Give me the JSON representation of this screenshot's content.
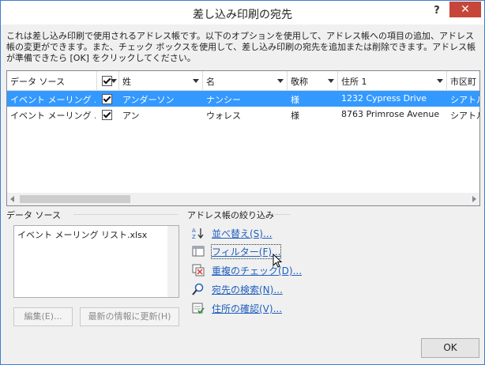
{
  "window": {
    "title": "差し込み印刷の宛先",
    "help": "?",
    "close": "✕"
  },
  "description": "これは差し込み印刷で使用されるアドレス帳です。以下のオプションを使用して、アドレス帳への項目の追加、アドレス帳の変更ができます。また、チェック ボックスを使用して、差し込み印刷の宛先を追加または削除できます。アドレス帳が準備できたら [OK] をクリックしてください。",
  "grid": {
    "columns": [
      "データ ソース",
      "",
      "姓",
      "名",
      "敬称",
      "住所 1",
      "市区町"
    ],
    "rows": [
      {
        "source": "イベント メーリング ...",
        "checked": true,
        "last": "アンダーソン",
        "first": "ナンシー",
        "title": "様",
        "address": "1232 Cypress Drive",
        "city": "シアトル"
      },
      {
        "source": "イベント メーリング ...",
        "checked": true,
        "last": "アン",
        "first": "ウォレス",
        "title": "様",
        "address": "8763 Primrose Avenue",
        "city": "シアトル"
      }
    ]
  },
  "datasource": {
    "label": "データ ソース",
    "items": [
      "イベント メーリング リスト.xlsx"
    ],
    "edit_button": "編集(E)...",
    "refresh_button": "最新の情報に更新(H)"
  },
  "refine": {
    "label": "アドレス帳の絞り込み",
    "links": [
      {
        "label": "並べ替え(S)...",
        "icon": "sort-icon"
      },
      {
        "label": "フィルター(F)...",
        "icon": "filter-icon"
      },
      {
        "label": "重複のチェック(D)...",
        "icon": "duplicate-icon"
      },
      {
        "label": "宛先の検索(N)...",
        "icon": "find-recipient-icon"
      },
      {
        "label": "住所の確認(V)...",
        "icon": "validate-address-icon"
      }
    ]
  },
  "ok_button": "OK"
}
